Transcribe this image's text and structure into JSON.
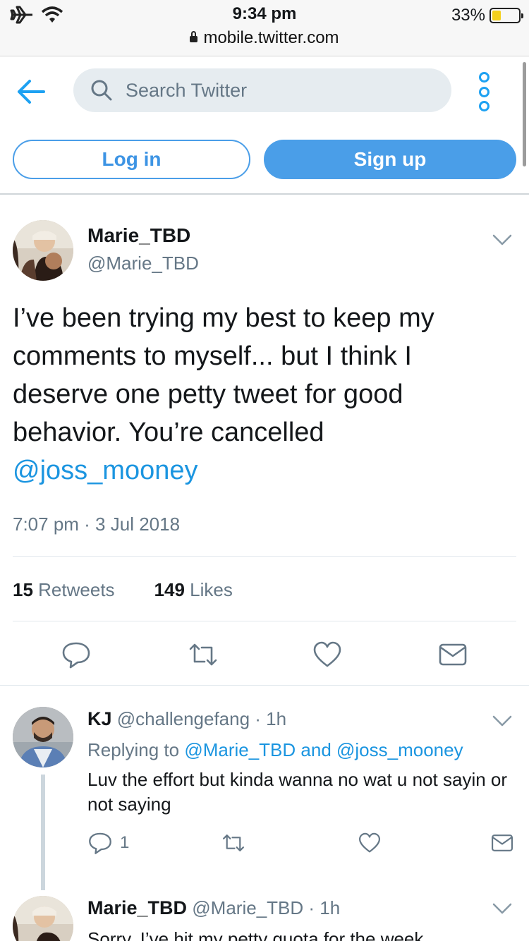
{
  "status_bar": {
    "time": "9:34 pm",
    "url": "mobile.twitter.com",
    "battery": "33%",
    "battery_level": 0.33
  },
  "header": {
    "search_placeholder": "Search Twitter",
    "login_label": "Log in",
    "signup_label": "Sign up"
  },
  "tweet": {
    "display_name": "Marie_TBD",
    "handle": "@Marie_TBD",
    "text": "I’ve been trying my best to keep my comments to myself... but I think I deserve one petty tweet for good behavior. You’re cancelled",
    "mention": "@joss_mooney",
    "timestamp": "7:07 pm · 3 Jul 2018",
    "retweets_count": "15",
    "retweets_label": "Retweets",
    "likes_count": "149",
    "likes_label": "Likes",
    "icons": [
      "reply-icon",
      "retweet-icon",
      "like-icon",
      "message-icon"
    ]
  },
  "replies": [
    {
      "display_name": "KJ",
      "handle": "@challengefang",
      "time": " · 1h",
      "replying_prefix": "Replying to",
      "replying_to": "@Marie_TBD and @joss_mooney",
      "text": "Luv the effort but kinda wanna no wat u not sayin or not saying",
      "reply_count": "1"
    },
    {
      "display_name": "Marie_TBD",
      "handle": "@Marie_TBD",
      "time": " · 1h",
      "text": "Sorry, I’ve hit my petty quota for the week"
    }
  ],
  "colors": {
    "accent": "#1da1f2",
    "button_blue": "#4a9ee8",
    "muted_text": "#657786",
    "search_bg": "#e6ecf0"
  }
}
